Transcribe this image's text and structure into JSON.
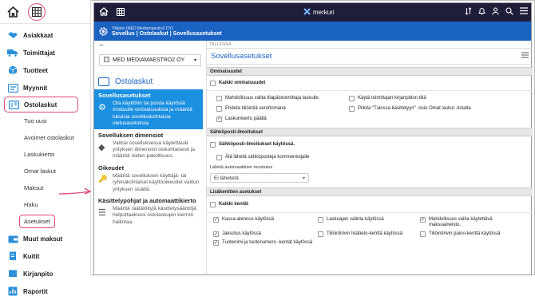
{
  "sidebar": {
    "items": [
      {
        "label": "Asiakkaat",
        "icon": "handshake-icon"
      },
      {
        "label": "Toimittajat",
        "icon": "truck-icon"
      },
      {
        "label": "Tuotteet",
        "icon": "box-icon"
      },
      {
        "label": "Myynnit",
        "icon": "sales-icon"
      },
      {
        "label": "Ostolaskut",
        "icon": "invoice-icon"
      }
    ],
    "sub": [
      "Tuo uusi",
      "Avoimet ostolaskut",
      "Laskukierto",
      "Omat laskut",
      "Maksut",
      "Haku",
      "Asetukset"
    ],
    "items2": [
      {
        "label": "Muut maksut",
        "icon": "wallet-icon"
      },
      {
        "label": "Kuitit",
        "icon": "receipt-icon"
      },
      {
        "label": "Kirjanpito",
        "icon": "book-icon"
      },
      {
        "label": "Raportit",
        "icon": "report-icon"
      }
    ]
  },
  "app": {
    "logo": "merkuri",
    "header": {
      "company_line": "Ylläpito (MED Mediamaestro2 OY)",
      "breadcrumb": "Sovellus | Ostolaskut | Sovellusasetukset"
    },
    "company_select": "MED MEDIAMAESTRO2 OY",
    "section_title": "Ostolaskut",
    "cards": [
      {
        "title": "Sovellusasetukset",
        "desc": "Ota käyttöön tai poista käytöstä moduulin ominaisuuksia ja määritä lukuisia sovelluskohtaisia oletusasetuksia.",
        "icon": "⚙"
      },
      {
        "title": "Sovelluksen dimensiot",
        "desc": "Valitse sovelluksessa käytettävät yrityksen dimensiot oiskohtaisesti ja määritä niiden pakollisuus.",
        "icon": "◆"
      },
      {
        "title": "Oikeudet",
        "desc": "Määritä sovelluksen käyttäjä- tai ryhmäkohtaiset käyttöoikeudet valitun yrityksen sisällä.",
        "icon": "🔑"
      },
      {
        "title": "Käsittelypohjat ja automaattikierto",
        "desc": "Määritä räätälöityjä käsittelysääntöjä helpottaaksesi ostolaskujen kierron hallintaa.",
        "icon": "☰"
      }
    ],
    "save_label": "TALLENNA",
    "right_title": "Sovellusasetukset",
    "sections": {
      "ominaisuudet": "Ominaisuudet",
      "all_features": "Kaikki ominaisuudet",
      "features": [
        {
          "label": "Mahdollisuus valita tilapäistoimittaja laskulle.",
          "checked": false
        },
        {
          "label": "Käytä toimittajan kirjanpidon tiliä",
          "checked": false
        },
        {
          "label": "Ehdota tiliöintiä verottomana",
          "checked": false
        },
        {
          "label": "Piilota \"Tulossa käsittelyyn\" -osio Omat laskut -listalta",
          "checked": false
        },
        {
          "label": "Laskunkierto päällä",
          "checked": true
        }
      ],
      "email_title": "Sähköposti-ilmoitukset",
      "email_enabled": "Sähköposti-ilmoitukset käytössä.",
      "email_comments": "Älä lähetä sähköposteja kommentoijalle",
      "auto_reminder_label": "Lähetä automaattinen muistutus",
      "auto_reminder_value": "Ei lähetetä",
      "extra_title": "Lisäkenttien asetukset",
      "all_fields": "Kaikki kentät",
      "fields": [
        {
          "label": "Kassa-alennus käytössä",
          "checked": true
        },
        {
          "label": "Laskuajan valinta käytössä",
          "checked": false
        },
        {
          "label": "Mahdollisuus valita käytettävä maksuaineisto.",
          "checked": true
        },
        {
          "label": "Jaksotus käytössä",
          "checked": true
        },
        {
          "label": "Tiliöintirivin lisätieto-kenttä käytössä",
          "checked": false
        },
        {
          "label": "Tiliöintirivin paino-kenttä käytössä",
          "checked": false
        },
        {
          "label": "Tuotenimi ja tuotenumero -kentät käytössä",
          "checked": true
        }
      ]
    }
  }
}
